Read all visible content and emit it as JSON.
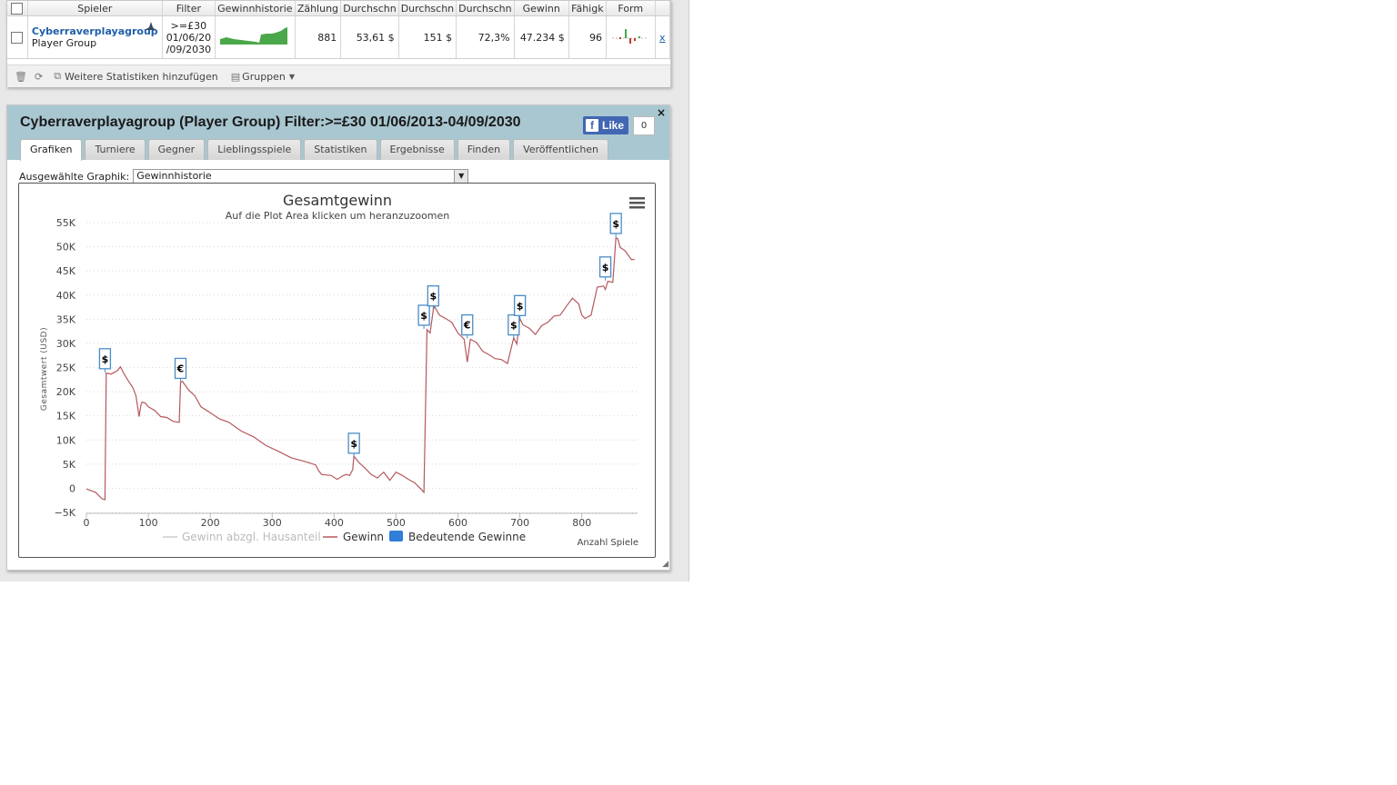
{
  "table": {
    "headers": [
      "Spieler",
      "Filter",
      "Gewinnhistorie",
      "Zählung",
      "Durchschn",
      "Durchschn",
      "Durchschn",
      "Gewinn",
      "Fähigk",
      "Form"
    ],
    "row": {
      "player_name": "Cyberraverplayagroup",
      "player_sub": "Player Group",
      "filter_line1": ">=£30",
      "filter_line2": "01/06/20",
      "filter_line3": "/09/2030",
      "count": "881",
      "avg1": "53,61 $",
      "avg2": "151 $",
      "avg3": "72,3%",
      "profit": "47.234 $",
      "ability": "96",
      "remove": "x"
    }
  },
  "toolbar": {
    "add_stats_label": "Weitere Statistiken hinzufügen",
    "groups_label": "Gruppen"
  },
  "details": {
    "title": "Cyberraverplayagroup (Player Group) Filter:>=£30 01/06/2013-04/09/2030",
    "close": "×",
    "like_label": "Like",
    "like_count": "0",
    "tabs": [
      "Grafiken",
      "Turniere",
      "Gegner",
      "Lieblingsspiele",
      "Statistiken",
      "Ergebnisse",
      "Finden",
      "Veröffentlichen"
    ],
    "graph_select_label": "Ausgewählte Graphik:",
    "graph_select_value": "Gewinnhistorie"
  },
  "colors": {
    "accent_blue": "#1f5fa8",
    "header_bg": "#a9c7d1",
    "line_profit": "#b5585e",
    "flag_border": "#4a8cc7",
    "sparkline": "#4aa84a"
  },
  "chart_data": {
    "type": "line",
    "title": "Gesamtgewinn",
    "subtitle": "Auf die Plot Area klicken um heranzuzoomen",
    "ylabel": "Gesamtwert (USD)",
    "xlabel": "Anzahl Spiele",
    "xlim": [
      0,
      890
    ],
    "ylim": [
      -5000,
      55000
    ],
    "x_ticks": [
      "0",
      "100",
      "200",
      "300",
      "400",
      "500",
      "600",
      "700",
      "800"
    ],
    "y_ticks": [
      "−5K",
      "0",
      "5K",
      "10K",
      "15K",
      "20K",
      "25K",
      "30K",
      "35K",
      "40K",
      "45K",
      "50K",
      "55K"
    ],
    "grid": true,
    "legend": [
      "Gewinn abzgl. Hausanteil",
      "Gewinn",
      "Bedeutende Gewinne"
    ],
    "series": [
      {
        "name": "Gewinn",
        "x": [
          0,
          15,
          25,
          30,
          32,
          40,
          50,
          55,
          60,
          68,
          75,
          80,
          85,
          88,
          90,
          95,
          100,
          110,
          120,
          130,
          140,
          150,
          152,
          155,
          165,
          175,
          185,
          200,
          215,
          230,
          250,
          270,
          290,
          310,
          330,
          350,
          370,
          375,
          380,
          395,
          405,
          415,
          420,
          425,
          430,
          432,
          440,
          450,
          460,
          470,
          480,
          490,
          500,
          510,
          520,
          530,
          540,
          545,
          550,
          555,
          560,
          562,
          570,
          580,
          590,
          600,
          610,
          615,
          620,
          630,
          640,
          650,
          660,
          670,
          680,
          690,
          695,
          700,
          705,
          715,
          725,
          735,
          745,
          755,
          765,
          775,
          785,
          795,
          800,
          805,
          815,
          825,
          835,
          838,
          842,
          850,
          855,
          858,
          862,
          870,
          880,
          885
        ],
        "y": [
          0,
          -1000,
          -2000,
          -2500,
          24000,
          23500,
          24500,
          25000,
          24000,
          22000,
          21000,
          19000,
          15000,
          17000,
          18000,
          17500,
          17000,
          16000,
          15000,
          14500,
          14000,
          13500,
          22000,
          22000,
          20500,
          19000,
          17000,
          15500,
          14500,
          13500,
          12000,
          10500,
          9000,
          7500,
          6500,
          5500,
          5000,
          3500,
          3000,
          2500,
          2000,
          2500,
          3000,
          2500,
          4000,
          6500,
          5500,
          4000,
          3000,
          2000,
          3500,
          1500,
          3500,
          2500,
          2000,
          1000,
          0,
          -1000,
          33000,
          32000,
          37000,
          37500,
          36000,
          35000,
          34500,
          32000,
          31000,
          26000,
          31000,
          30000,
          28500,
          27500,
          27000,
          26500,
          26000,
          31000,
          30000,
          35000,
          34000,
          33000,
          32000,
          33500,
          34500,
          35500,
          36000,
          37500,
          39500,
          38000,
          36000,
          35000,
          36000,
          41500,
          42000,
          41000,
          43000,
          42500,
          52000,
          51500,
          50000,
          49000,
          47500,
          47234
        ]
      }
    ],
    "flags": [
      {
        "x": 30,
        "y": 24000,
        "label": "$"
      },
      {
        "x": 152,
        "y": 22000,
        "label": "€"
      },
      {
        "x": 432,
        "y": 6500,
        "label": "$"
      },
      {
        "x": 545,
        "y": 33000,
        "label": "$"
      },
      {
        "x": 560,
        "y": 37000,
        "label": "$"
      },
      {
        "x": 615,
        "y": 31000,
        "label": "€"
      },
      {
        "x": 690,
        "y": 31000,
        "label": "$"
      },
      {
        "x": 700,
        "y": 35000,
        "label": "$"
      },
      {
        "x": 838,
        "y": 43000,
        "label": "$"
      },
      {
        "x": 855,
        "y": 52000,
        "label": "$"
      }
    ]
  }
}
